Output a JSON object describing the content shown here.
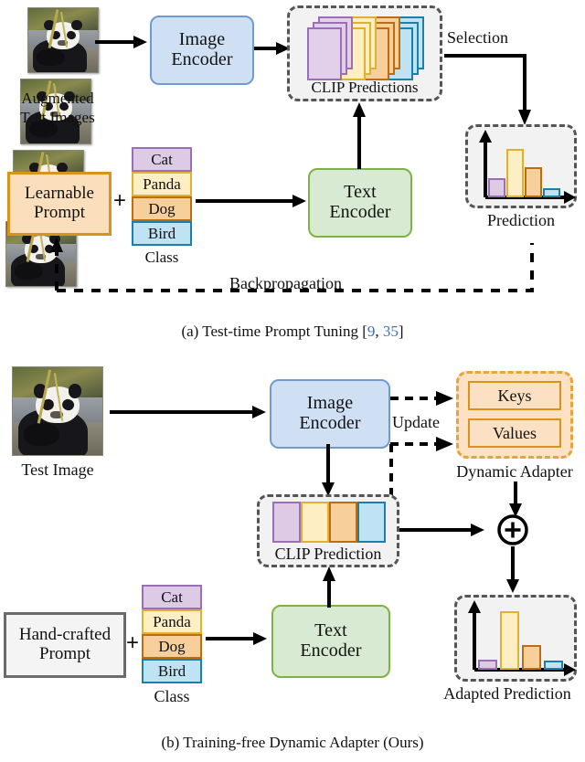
{
  "panel_a": {
    "caption_prefix": "(a) Test-time Prompt Tuning [",
    "caption_ref1": "9",
    "caption_sep": ", ",
    "caption_ref2": "35",
    "caption_suffix": "]",
    "image_label_line1": "Augmented",
    "image_label_line2": "Test Images",
    "image_encoder": "Image\nEncoder",
    "image_encoder_l1": "Image",
    "image_encoder_l2": "Encoder",
    "text_encoder_l1": "Text",
    "text_encoder_l2": "Encoder",
    "prompt_l1": "Learnable",
    "prompt_l2": "Prompt",
    "plus": "+",
    "classes": [
      "Cat",
      "Panda",
      "Dog",
      "Bird"
    ],
    "class_label": "Class",
    "clip_predictions_label": "CLIP Predictions",
    "selection_label": "Selection",
    "prediction_label": "Prediction",
    "backprop_label": "Backpropagation"
  },
  "panel_b": {
    "caption": "(b) Training-free Dynamic Adapter (Ours)",
    "image_label": "Test Image",
    "image_encoder_l1": "Image",
    "image_encoder_l2": "Encoder",
    "text_encoder_l1": "Text",
    "text_encoder_l2": "Encoder",
    "prompt_l1": "Hand-crafted",
    "prompt_l2": "Prompt",
    "plus": "+",
    "classes": [
      "Cat",
      "Panda",
      "Dog",
      "Bird"
    ],
    "class_label": "Class",
    "update_label": "Update",
    "keys_label": "Keys",
    "values_label": "Values",
    "dynamic_adapter_label": "Dynamic Adapter",
    "clip_prediction_label": "CLIP Prediction",
    "adapted_prediction_label": "Adapted Prediction",
    "sum_symbol": "+"
  },
  "colors": {
    "cat": "#ddcbe6",
    "cat_border": "#9a6fb5",
    "panda": "#fdeec4",
    "panda_border": "#e0b030",
    "dog": "#f6cf9b",
    "dog_border": "#bf6c10",
    "bird": "#bfe3f3",
    "bird_border": "#1a7fab",
    "image_encoder": "#cfe0f5",
    "image_encoder_border": "#6f9bd1",
    "text_encoder": "#d9ead3",
    "text_encoder_border": "#7cb342",
    "learnable_prompt": "#fbdfbd",
    "learnable_prompt_border": "#d9921a",
    "hand_prompt": "#f4f4f4",
    "hand_prompt_border": "#6b6b6b",
    "adapter_fill": "#fce1c2",
    "adapter_border": "#e8a33d",
    "dash_group": "#f2f2f2",
    "dash_group_border": "#555555",
    "citation": "#3d6fb5"
  },
  "chart_data": [
    {
      "type": "bar",
      "title": "Prediction",
      "categories": [
        "Cat",
        "Panda",
        "Dog",
        "Bird"
      ],
      "values": [
        30,
        78,
        48,
        12
      ],
      "ylim": [
        0,
        100
      ],
      "xlabel": "",
      "ylabel": "",
      "grid": false,
      "legend": "none",
      "colors": [
        "#ddcbe6",
        "#fdeec4",
        "#f6cf9b",
        "#bfe3f3"
      ]
    },
    {
      "type": "bar",
      "title": "Adapted Prediction",
      "categories": [
        "Cat",
        "Panda",
        "Dog",
        "Bird"
      ],
      "values": [
        11,
        92,
        38,
        9
      ],
      "ylim": [
        0,
        100
      ],
      "xlabel": "",
      "ylabel": "",
      "grid": false,
      "legend": "none",
      "colors": [
        "#ddcbe6",
        "#fdeec4",
        "#f6cf9b",
        "#bfe3f3"
      ]
    }
  ]
}
